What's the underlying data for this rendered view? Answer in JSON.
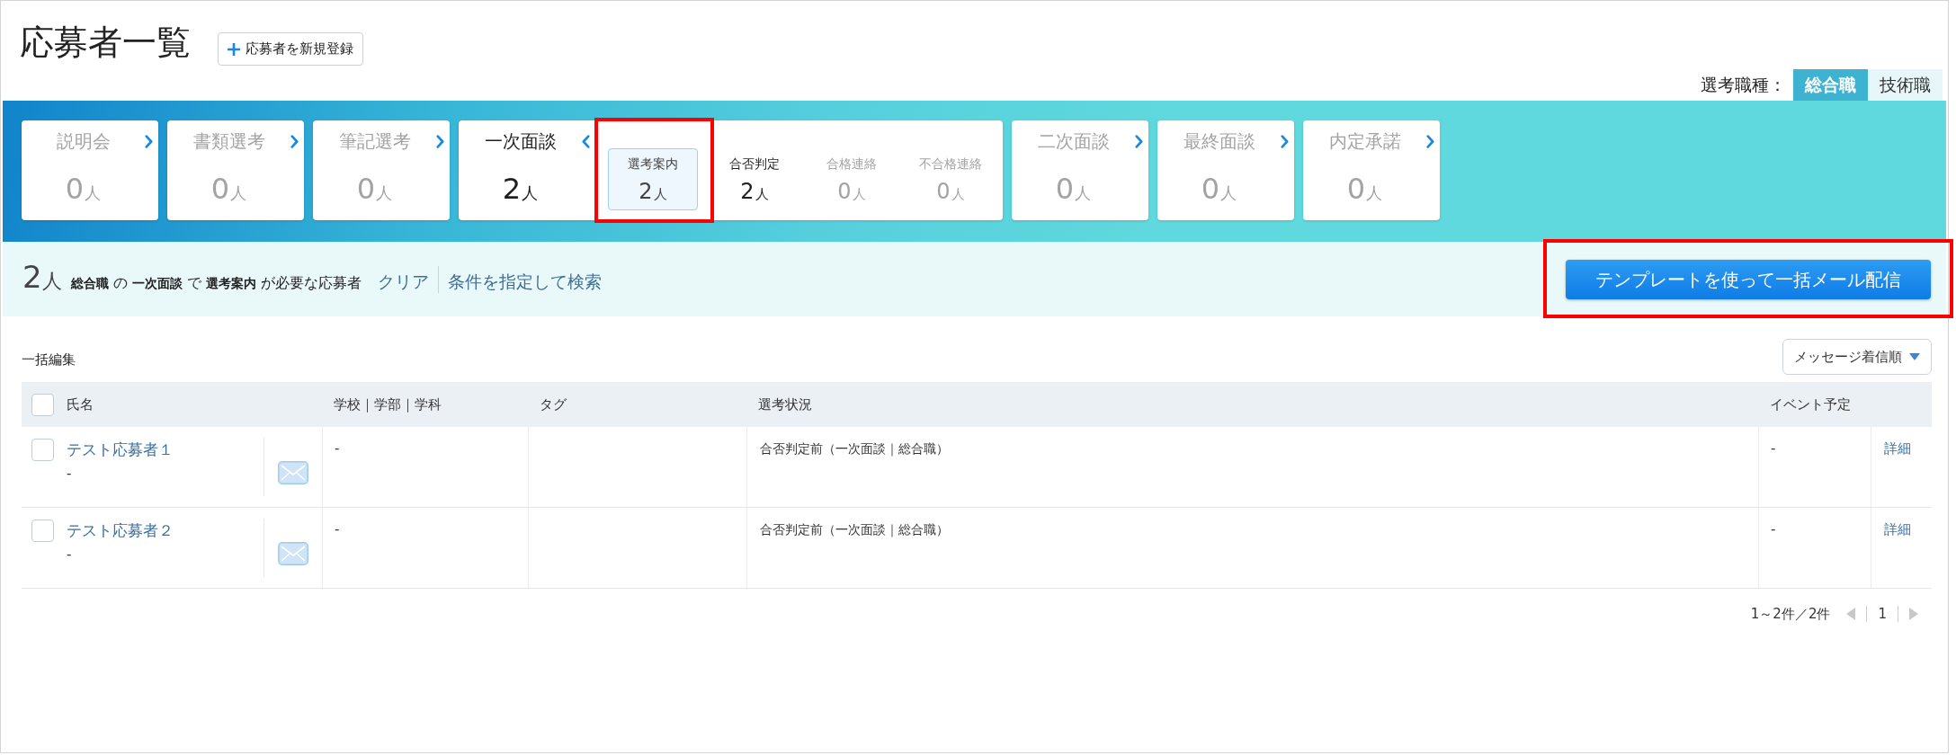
{
  "page": {
    "title": "応募者一覧",
    "add_button": "応募者を新規登録"
  },
  "job_type": {
    "label": "選考職種：",
    "options": [
      {
        "label": "総合職",
        "selected": true
      },
      {
        "label": "技術職",
        "selected": false
      }
    ]
  },
  "stages": [
    {
      "label": "説明会",
      "count": "0",
      "unit": "人",
      "muted": true,
      "expanded": false
    },
    {
      "label": "書類選考",
      "count": "0",
      "unit": "人",
      "muted": true,
      "expanded": false
    },
    {
      "label": "筆記選考",
      "count": "0",
      "unit": "人",
      "muted": true,
      "expanded": false
    },
    {
      "label": "一次面談",
      "count": "2",
      "unit": "人",
      "muted": false,
      "expanded": true,
      "substages": [
        {
          "label": "選考案内",
          "count": "2",
          "unit": "人",
          "selected": true,
          "muted": false,
          "highlighted": true
        },
        {
          "label": "合否判定",
          "count": "2",
          "unit": "人",
          "selected": false,
          "muted": false,
          "highlighted": false
        },
        {
          "label": "合格連絡",
          "count": "0",
          "unit": "人",
          "selected": false,
          "muted": true,
          "highlighted": false
        },
        {
          "label": "不合格連絡",
          "count": "0",
          "unit": "人",
          "selected": false,
          "muted": true,
          "highlighted": false
        }
      ]
    },
    {
      "label": "二次面談",
      "count": "0",
      "unit": "人",
      "muted": true,
      "expanded": false
    },
    {
      "label": "最終面談",
      "count": "0",
      "unit": "人",
      "muted": true,
      "expanded": false
    },
    {
      "label": "内定承諾",
      "count": "0",
      "unit": "人",
      "muted": true,
      "expanded": false
    }
  ],
  "filter": {
    "count": "2",
    "unit": "人",
    "description": "**総合職** の **一次面談** で **選考案内** が必要な応募者",
    "clear_link": "クリア",
    "search_link": "条件を指定して検索"
  },
  "bulk_mail_button": {
    "label": "テンプレートを使って一括メール配信",
    "highlighted": true
  },
  "toolbar": {
    "bulk_edit": "一括編集",
    "sort": "メッセージ着信順"
  },
  "table": {
    "select_all_checked": false,
    "columns": [
      "氏名",
      "学校｜学部｜学科",
      "タグ",
      "選考状況",
      "イベント予定"
    ],
    "rows": [
      {
        "checked": false,
        "name": "テスト応募者１",
        "subtext": "-",
        "school": "-",
        "status": "合否判定前（一次面談｜総合職）",
        "event": "-",
        "detail_link": "詳細"
      },
      {
        "checked": false,
        "name": "テスト応募者２",
        "subtext": "-",
        "school": "-",
        "status": "合否判定前（一次面談｜総合職）",
        "event": "-",
        "detail_link": "詳細"
      }
    ]
  },
  "pagination": {
    "summary": "1～2件／2件",
    "current_page": "1",
    "previous_disabled": true,
    "next_disabled": true
  }
}
